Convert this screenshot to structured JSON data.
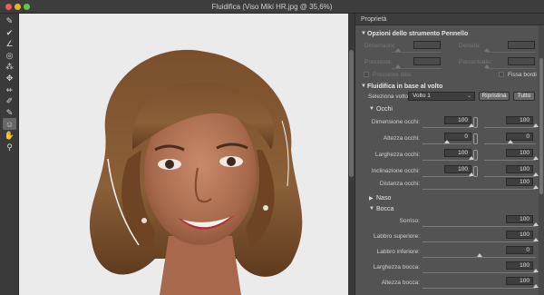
{
  "window": {
    "title": "Fluidifica (Viso Miki HR.jpg @ 35,6%)"
  },
  "toolbar": {
    "tools": [
      {
        "name": "forward-warp-tool-icon",
        "glyph": "✎"
      },
      {
        "name": "reconstruct-tool-icon",
        "glyph": "✔"
      },
      {
        "name": "smooth-tool-icon",
        "glyph": "∠"
      },
      {
        "name": "twirl-tool-icon",
        "glyph": "◎"
      },
      {
        "name": "pucker-tool-icon",
        "glyph": "⁂"
      },
      {
        "name": "bloat-tool-icon",
        "glyph": "✥"
      },
      {
        "name": "push-left-tool-icon",
        "glyph": "⇷"
      },
      {
        "name": "freeze-mask-tool-icon",
        "glyph": "✐"
      },
      {
        "name": "thaw-mask-tool-icon",
        "glyph": "✎"
      },
      {
        "name": "face-tool-icon",
        "glyph": "☺"
      },
      {
        "name": "hand-tool-icon",
        "glyph": "✋"
      },
      {
        "name": "zoom-tool-icon",
        "glyph": "⚲"
      }
    ]
  },
  "panel": {
    "title": "Proprietà",
    "brush": {
      "title": "Opzioni dello strumento Pennello",
      "dimensioni_label": "Dimensioni:",
      "densita_label": "Densità:",
      "pressione_label": "Pressione:",
      "percentuale_label": "Percentuale:",
      "pressione_stilo": "Pressione stilo",
      "fissa_bordi": "Fissa bordi"
    },
    "face": {
      "title": "Fluidifica in base al volto",
      "seleziona_label": "Seleziona volto:",
      "selected": "Volto 1",
      "ripristina": "Ripristina",
      "tutto": "Tutto"
    },
    "occhi": {
      "title": "Occhi",
      "rows": [
        {
          "label": "Dimensione occhi:",
          "left": "100",
          "right": "100",
          "left_frac": 1.0,
          "right_frac": 1.0
        },
        {
          "label": "Altezza occhi:",
          "left": "0",
          "right": "0",
          "left_frac": 0.5,
          "right_frac": 0.5
        },
        {
          "label": "Larghezza occhi:",
          "left": "100",
          "right": "100",
          "left_frac": 1.0,
          "right_frac": 1.0
        },
        {
          "label": "Inclinazione occhi:",
          "left": "100",
          "right": "100",
          "left_frac": 1.0,
          "right_frac": 1.0
        }
      ],
      "distanza": {
        "label": "Distanza occhi:",
        "value": "100",
        "frac": 1.0
      }
    },
    "naso": {
      "title": "Naso"
    },
    "bocca": {
      "title": "Bocca",
      "rows": [
        {
          "label": "Sorriso:",
          "value": "100",
          "frac": 1.0
        },
        {
          "label": "Labbro superiore:",
          "value": "100",
          "frac": 1.0
        },
        {
          "label": "Labbro inferiore:",
          "value": "0",
          "frac": 0.5
        },
        {
          "label": "Larghezza bocca:",
          "value": "100",
          "frac": 1.0
        },
        {
          "label": "Altezza bocca:",
          "value": "100",
          "frac": 1.0
        }
      ]
    }
  }
}
